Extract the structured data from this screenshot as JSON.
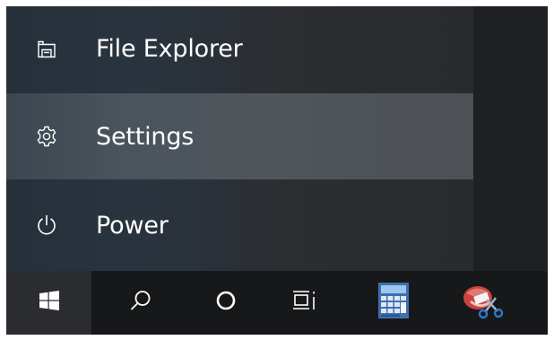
{
  "start_menu": {
    "items": [
      {
        "label": "File Explorer",
        "icon": "file-explorer-icon"
      },
      {
        "label": "Settings",
        "icon": "gear-icon",
        "highlighted": true
      },
      {
        "label": "Power",
        "icon": "power-icon"
      }
    ]
  },
  "taskbar": {
    "buttons": [
      {
        "icon": "windows-logo-icon"
      },
      {
        "icon": "search-icon"
      },
      {
        "icon": "cortana-icon"
      },
      {
        "icon": "task-view-icon"
      },
      {
        "icon": "calculator-icon"
      },
      {
        "icon": "snipping-tool-icon"
      }
    ]
  },
  "colors": {
    "taskbar": "#17181a",
    "menu_background": "#2a343e",
    "hover_highlight": "#4a545c",
    "text": "#ffffff"
  }
}
